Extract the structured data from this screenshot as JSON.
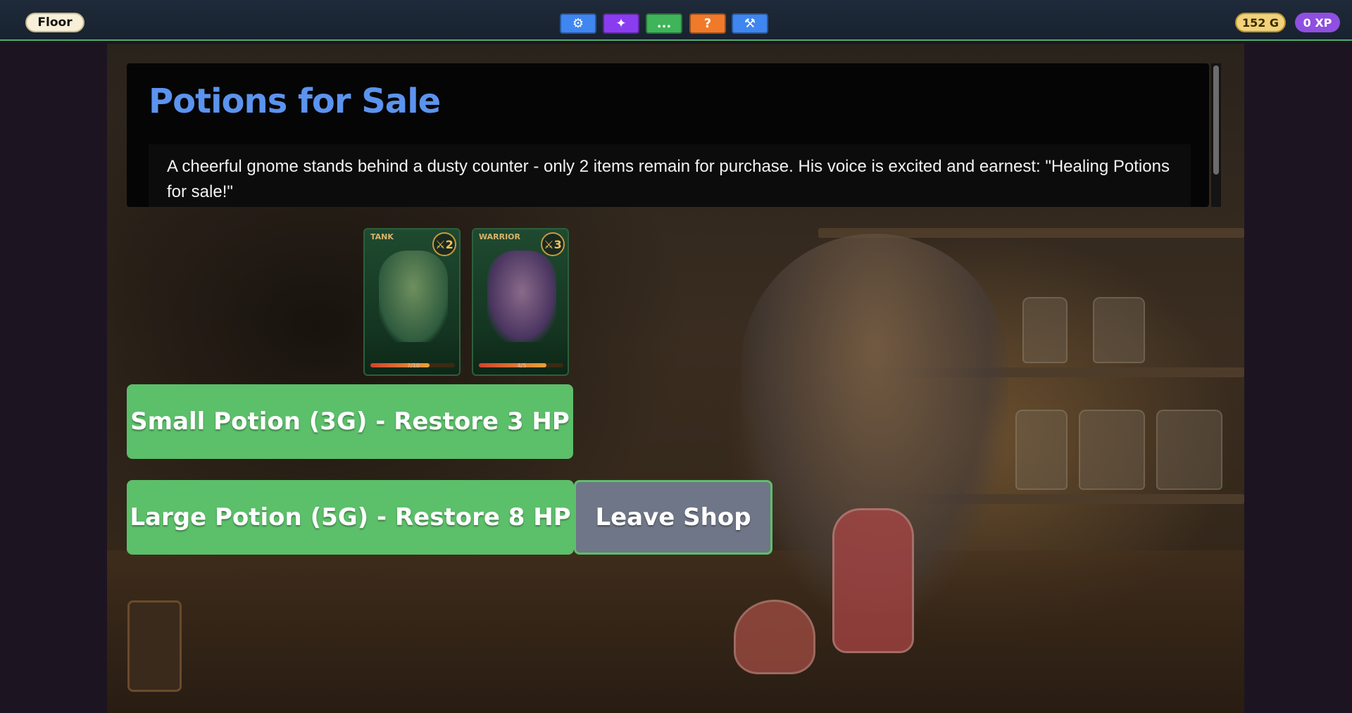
{
  "topbar": {
    "floor_label": "Floor",
    "gold": "152 G",
    "xp": "0 XP",
    "buttons": {
      "settings_glyph": "⚙",
      "magic_glyph": "✦",
      "chat_glyph": "...",
      "help_glyph": "?",
      "tools_glyph": "⚒"
    }
  },
  "event": {
    "title": "Potions for Sale",
    "description": "A cheerful gnome stands behind a dusty counter - only 2 items remain for purchase. His voice is excited and earnest: \"Healing Potions for sale!\""
  },
  "party": [
    {
      "role": "TANK",
      "power": "⚔2",
      "hp_text": "7/10",
      "hp_fraction": 0.7
    },
    {
      "role": "WARRIOR",
      "power": "⚔3",
      "hp_text": "4/5",
      "hp_fraction": 0.8
    }
  ],
  "actions": {
    "small_potion": "Small Potion (3G) - Restore 3 HP",
    "large_potion": "Large Potion (5G) - Restore 8 HP",
    "leave": "Leave Shop"
  },
  "colors": {
    "accent_green": "#5cbf6a",
    "title_blue": "#5b93ee",
    "gold": "#f2d27a",
    "xp_purple": "#8f4fe0"
  }
}
